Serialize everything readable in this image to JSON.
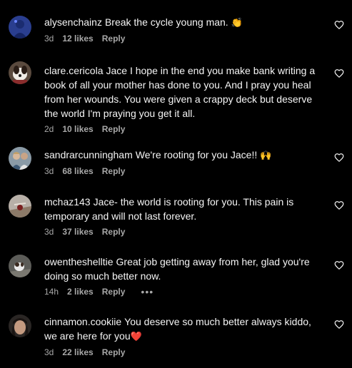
{
  "comments": [
    {
      "username": "alysenchainz",
      "text": "Break the cycle young man.",
      "emoji": "👏",
      "time": "3d",
      "likes": "12 likes",
      "reply": "Reply"
    },
    {
      "username": "clare.cericola",
      "text": "Jace I hope in the end you make bank writing a book of all your mother has done to you. And I pray you heal from her wounds. You were given a crappy deck but deserve the world I'm praying you get it all.",
      "emoji": "",
      "time": "2d",
      "likes": "10 likes",
      "reply": "Reply"
    },
    {
      "username": "sandrarcunningham",
      "text": "We're rooting for you Jace!!",
      "emoji": "🙌",
      "time": "3d",
      "likes": "68 likes",
      "reply": "Reply"
    },
    {
      "username": "mchaz143",
      "text": "Jace- the world is rooting for you. This pain is temporary and will not last forever.",
      "emoji": "",
      "time": "3d",
      "likes": "37 likes",
      "reply": "Reply"
    },
    {
      "username": "owentheshelltie",
      "text": "Great job getting away from her, glad you're doing so much better now.",
      "emoji": "",
      "time": "14h",
      "likes": "2 likes",
      "reply": "Reply",
      "more": "•••"
    },
    {
      "username": "cinnamon.cookiie",
      "text": "You deserve so much better always kiddo, we are here for you",
      "emoji": "❤️",
      "time": "3d",
      "likes": "22 likes",
      "reply": "Reply"
    }
  ],
  "colors": {
    "background": "#000000",
    "text": "#f5f5f5",
    "muted": "#a8a8a8",
    "heart_emoji": "#ff3040"
  },
  "icons": {
    "like": "heart-outline-icon",
    "more": "more-options-icon"
  }
}
